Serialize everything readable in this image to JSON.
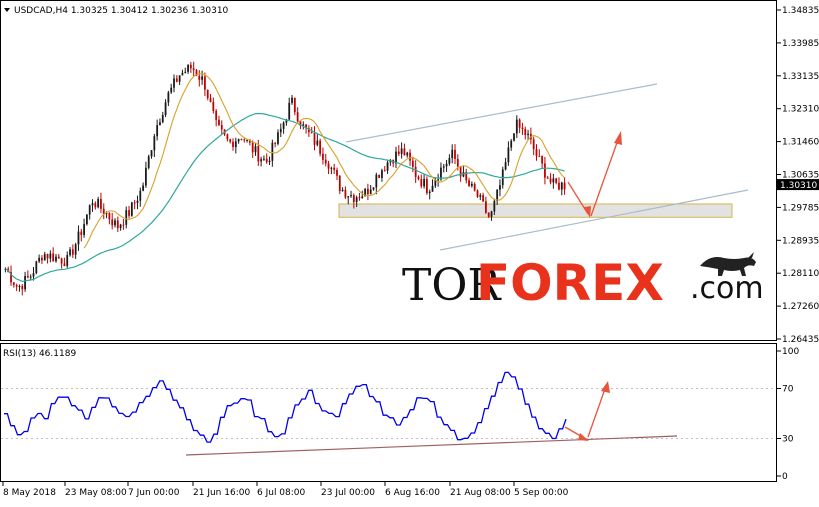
{
  "symbol_header": {
    "symbol": "USDCAD,H4",
    "open": "1.30325",
    "high": "1.30412",
    "low": "1.30236",
    "close": "1.30310"
  },
  "price_axis_labels": [
    "1.34835",
    "1.33985",
    "1.33135",
    "1.32310",
    "1.31460",
    "1.30635",
    "1.29785",
    "1.28935",
    "1.28110",
    "1.27260",
    "1.26435"
  ],
  "current_price_tag": "1.30310",
  "rsi_header": "RSI(13) 46.1189",
  "rsi_axis_labels": [
    "100",
    "70",
    "30",
    "0"
  ],
  "time_axis_labels": [
    "8 May 2018",
    "23 May 08:00",
    "7 Jun 00:00",
    "21 Jun 16:00",
    "6 Jul 08:00",
    "23 Jul 00:00",
    "6 Aug 16:00",
    "21 Aug 08:00",
    "5 Sep 00:00"
  ],
  "brand": {
    "tor": "TOR",
    "forex": "FOREX",
    "dotcom": ".com"
  },
  "colors": {
    "bull_candle": "#1a1a1a",
    "bear_candle": "#c00000",
    "ma_fast": "#d9a12a",
    "ma_slow": "#2fa89a",
    "channel": "#a9bccb",
    "zone_fill": "#e2e2e2",
    "zone_border": "#d6b44a",
    "forecast_arrow": "#e8543c",
    "rsi_line": "#0000ee",
    "rsi_trend": "#a06060",
    "price_tag_bg": "#000000"
  },
  "chart_data": [
    {
      "type": "candlestick",
      "title": "USDCAD,H4",
      "ylim": [
        1.2625,
        1.349
      ],
      "x": [
        "8 May 2018",
        "23 May 08:00",
        "7 Jun 00:00",
        "21 Jun 16:00",
        "6 Jul 08:00",
        "23 Jul 00:00",
        "6 Aug 16:00",
        "21 Aug 08:00",
        "5 Sep 00:00"
      ],
      "close_path": [
        1.281,
        1.276,
        1.279,
        1.285,
        1.284,
        1.283,
        1.29,
        1.299,
        1.296,
        1.292,
        1.296,
        1.302,
        1.317,
        1.326,
        1.332,
        1.334,
        1.33,
        1.318,
        1.314,
        1.316,
        1.312,
        1.309,
        1.316,
        1.325,
        1.318,
        1.314,
        1.309,
        1.302,
        1.3,
        1.301,
        1.306,
        1.31,
        1.312,
        1.306,
        1.302,
        1.307,
        1.311,
        1.304,
        1.3,
        1.294,
        1.305,
        1.319,
        1.316,
        1.309,
        1.303,
        1.303
      ],
      "overlays": [
        {
          "name": "moving average (fast)",
          "color": "#d9a12a"
        },
        {
          "name": "moving average (slow)",
          "color": "#2fa89a"
        }
      ],
      "support_zone": [
        1.2945,
        1.298
      ],
      "current_price": 1.3031
    },
    {
      "type": "line",
      "title": "RSI(13) 46.1189",
      "ylim": [
        0,
        100
      ],
      "levels": [
        70,
        30
      ],
      "values": [
        50,
        40,
        32,
        38,
        45,
        52,
        48,
        56,
        62,
        66,
        58,
        52,
        48,
        56,
        63,
        60,
        55,
        50,
        46,
        52,
        60,
        66,
        73,
        78,
        70,
        62,
        54,
        48,
        38,
        30,
        28,
        34,
        46,
        54,
        60,
        64,
        58,
        50,
        44,
        38,
        32,
        36,
        46,
        56,
        62,
        66,
        60,
        54,
        50,
        48,
        56,
        64,
        70,
        72,
        66,
        58,
        50,
        44,
        40,
        44,
        52,
        60,
        64,
        58,
        50,
        42,
        36,
        30,
        28,
        34,
        44,
        56,
        66,
        76,
        82,
        78,
        68,
        56,
        46,
        40,
        32,
        30,
        36,
        46
      ]
    }
  ]
}
